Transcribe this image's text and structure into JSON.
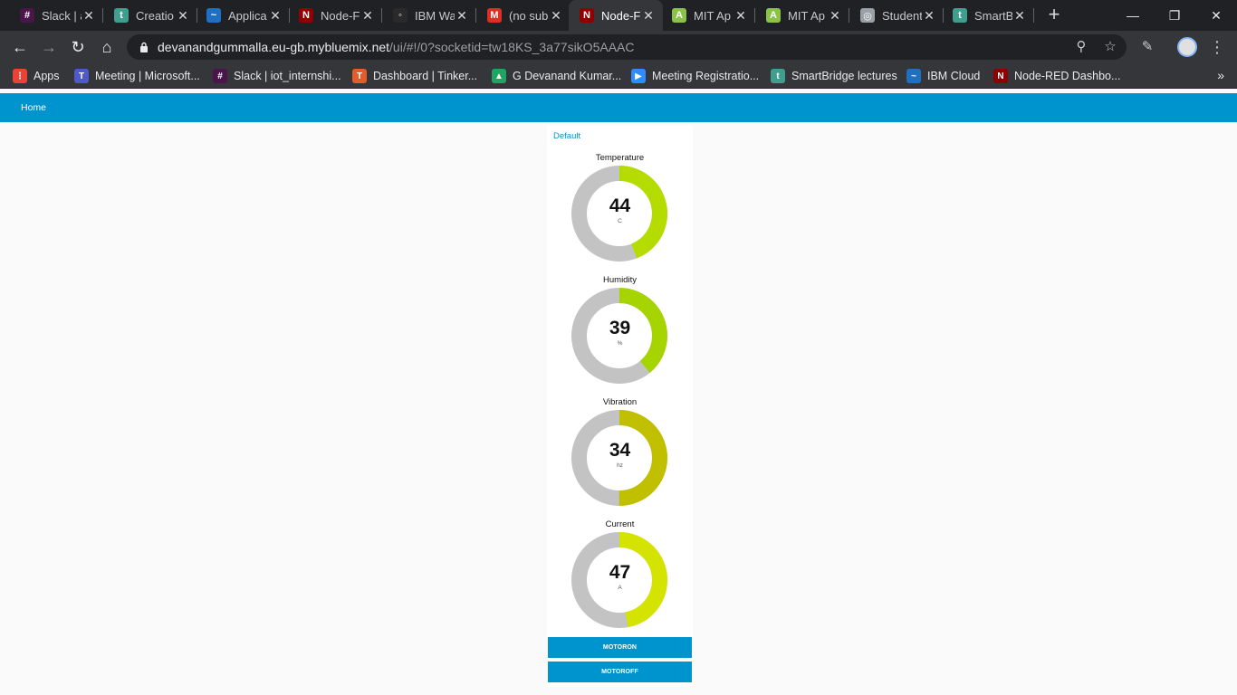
{
  "browser": {
    "tabs": [
      {
        "title": "Slack | a",
        "icon": "slack-icon",
        "color": "#4a154b",
        "glyph": "#",
        "active": false
      },
      {
        "title": "Creatio",
        "icon": "tinkercad-t-icon",
        "color": "#3f9e8e",
        "glyph": "t",
        "active": false
      },
      {
        "title": "Applica",
        "icon": "ibm-cloud-icon",
        "color": "#1f70c1",
        "glyph": "~",
        "active": false
      },
      {
        "title": "Node-F",
        "icon": "node-red-icon",
        "color": "#8f0000",
        "glyph": "N",
        "active": false
      },
      {
        "title": "IBM Wa",
        "icon": "ibm-watson-icon",
        "color": "#2a2a2a",
        "glyph": "◦",
        "active": false
      },
      {
        "title": "(no sub",
        "icon": "gmail-icon",
        "color": "#d93025",
        "glyph": "M",
        "active": false
      },
      {
        "title": "Node-F",
        "icon": "node-red-icon",
        "color": "#8f0000",
        "glyph": "N",
        "active": true
      },
      {
        "title": "MIT Ap",
        "icon": "mit-app-inventor-icon",
        "color": "#8bc34a",
        "glyph": "A",
        "active": false
      },
      {
        "title": "MIT Ap",
        "icon": "mit-app-inventor-icon",
        "color": "#8bc34a",
        "glyph": "A",
        "active": false
      },
      {
        "title": "Student",
        "icon": "globe-icon",
        "color": "#9aa0a6",
        "glyph": "◎",
        "active": false
      },
      {
        "title": "SmartB",
        "icon": "tinkercad-t-icon",
        "color": "#3f9e8e",
        "glyph": "t",
        "active": false
      }
    ],
    "url_host": "devanandgummalla.eu-gb.mybluemix.net",
    "url_rest": "/ui/#!/0?socketid=tw18KS_3a77sikO5AAAC",
    "bookmarks": [
      {
        "label": "Apps",
        "icon": "apps-grid-icon",
        "color": "#ea4335",
        "glyph": "⋮"
      },
      {
        "label": "Meeting | Microsoft...",
        "icon": "teams-icon",
        "color": "#5059c9",
        "glyph": "T"
      },
      {
        "label": "Slack | iot_internshi...",
        "icon": "slack-icon",
        "color": "#4a154b",
        "glyph": "#"
      },
      {
        "label": "Dashboard | Tinker...",
        "icon": "tinkercad-icon",
        "color": "#e35c2b",
        "glyph": "T"
      },
      {
        "label": "G Devanand Kumar...",
        "icon": "google-drive-icon",
        "color": "#1fa463",
        "glyph": "▲"
      },
      {
        "label": "Meeting Registratio...",
        "icon": "zoom-icon",
        "color": "#2d8cff",
        "glyph": "▶"
      },
      {
        "label": "SmartBridge lectures",
        "icon": "smartbridge-t-icon",
        "color": "#3f9e8e",
        "glyph": "t"
      },
      {
        "label": "IBM Cloud",
        "icon": "ibm-cloud-icon",
        "color": "#1f70c1",
        "glyph": "~"
      },
      {
        "label": "Node-RED Dashbo...",
        "icon": "node-red-icon",
        "color": "#8f0000",
        "glyph": "N"
      }
    ]
  },
  "app": {
    "nav_title": "Home",
    "group_title": "Default",
    "accent": "#0094ce",
    "gauges": [
      {
        "label": "Temperature",
        "value": "44",
        "unit": "C",
        "fraction": 0.44,
        "color": "#b5dc00"
      },
      {
        "label": "Humidity",
        "value": "39",
        "unit": "%",
        "fraction": 0.39,
        "color": "#a5d400"
      },
      {
        "label": "Vibration",
        "value": "34",
        "unit": "hz",
        "fraction": 0.5,
        "color": "#c0c000"
      },
      {
        "label": "Current",
        "value": "47",
        "unit": "A",
        "fraction": 0.47,
        "color": "#d4e400"
      }
    ],
    "gauge_track_color": "#c3c3c3",
    "buttons": [
      {
        "label": "MOTORON"
      },
      {
        "label": "MOTOROFF"
      }
    ]
  }
}
